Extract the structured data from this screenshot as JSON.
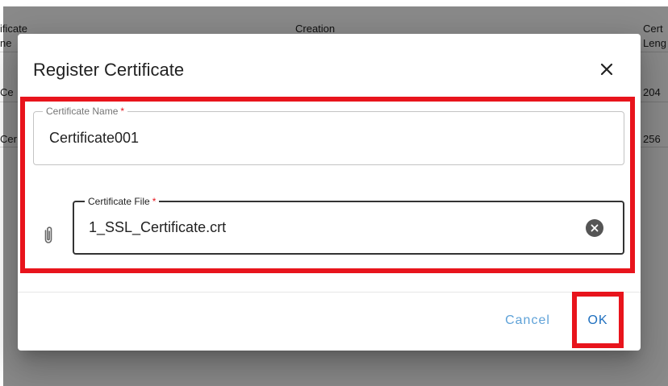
{
  "background_table": {
    "headers": {
      "certificate_name_line1": "ificate",
      "certificate_name_line2": "ne",
      "creation": "Creation",
      "certificate_length_line1": "Cert",
      "certificate_length_line2": "Leng"
    },
    "rows": [
      {
        "name": "Ce",
        "length": "204"
      },
      {
        "name": "Cer",
        "length": "256"
      }
    ]
  },
  "dialog": {
    "title": "Register Certificate",
    "close_icon": "close-icon",
    "certificate_name": {
      "label": "Certificate Name",
      "required_mark": "*",
      "value": "Certificate001"
    },
    "certificate_file": {
      "label": "Certificate File",
      "required_mark": "*",
      "value": "1_SSL_Certificate.crt",
      "attach_icon": "paperclip-icon",
      "clear_icon": "clear-circle-icon"
    },
    "buttons": {
      "cancel": "Cancel",
      "ok": "OK"
    }
  },
  "colors": {
    "highlight": "#e8141c",
    "ok_text": "#1e6fbf",
    "cancel_text": "#5fa2d8",
    "overlay": "rgba(0,0,0,0.46)"
  }
}
